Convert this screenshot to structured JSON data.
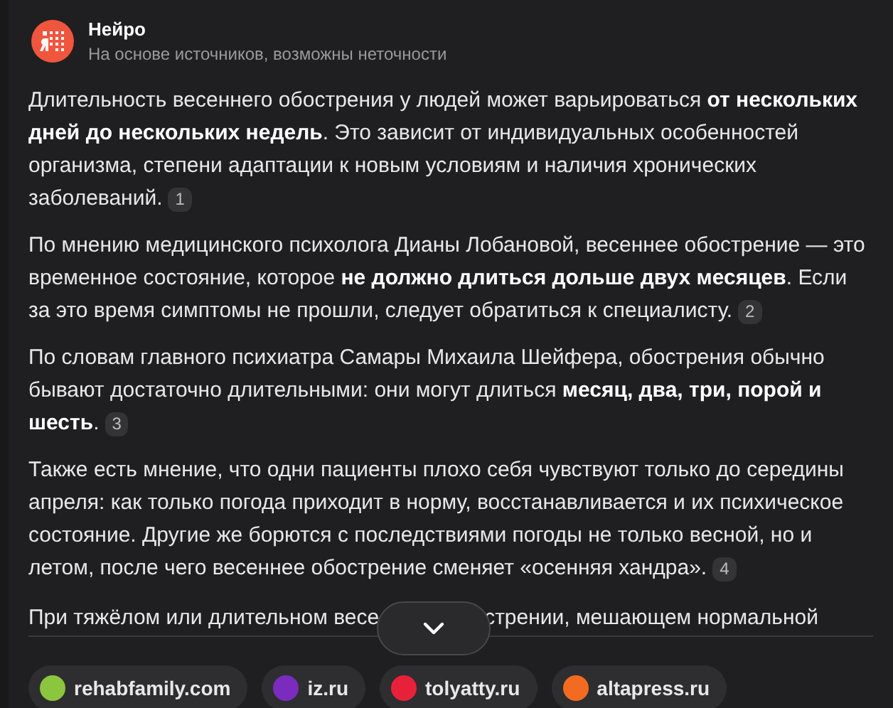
{
  "header": {
    "title": "Нейро",
    "subtitle": "На основе источников, возможны неточности"
  },
  "paragraphs": [
    {
      "text": "Длительность весеннего обострения у людей может варьироваться **от нескольких дней до нескольких недель**. Это зависит от индивидуальных особенностей организма, степени адаптации к новым условиям и наличия хронических заболеваний.",
      "citation": "1"
    },
    {
      "text": "По мнению медицинского психолога Дианы Лобановой, весеннее обострение — это временное состояние, которое **не должно длиться дольше двух месяцев**. Если за это время симптомы не прошли, следует обратиться к специалисту.",
      "citation": "2"
    },
    {
      "text": "По словам главного психиатра Самары Михаила Шейфера, обострения обычно бывают достаточно длительными: они могут длиться **месяц, два, три, порой и шесть**.",
      "citation": "3"
    },
    {
      "text": "Также есть мнение, что одни пациенты плохо себя чувствуют только до середины апреля: как только погода приходит в норму, восстанавливается и их психическое состояние. Другие же борются с последствиями погоды не только весной, но и летом, после чего весеннее обострение сменяет «осенняя хандра».",
      "citation": "4"
    }
  ],
  "last_line": {
    "before": "При тяжёлом или длительном весе",
    "after": "стрении, мешающем нормальной"
  },
  "sources": [
    {
      "name": "rehabfamily.com",
      "color": "#8cc63f"
    },
    {
      "name": "iz.ru",
      "color": "#7b2cbf"
    },
    {
      "name": "tolyatty.ru",
      "color": "#e8213a"
    },
    {
      "name": "altapress.ru",
      "color": "#f26b21"
    }
  ]
}
